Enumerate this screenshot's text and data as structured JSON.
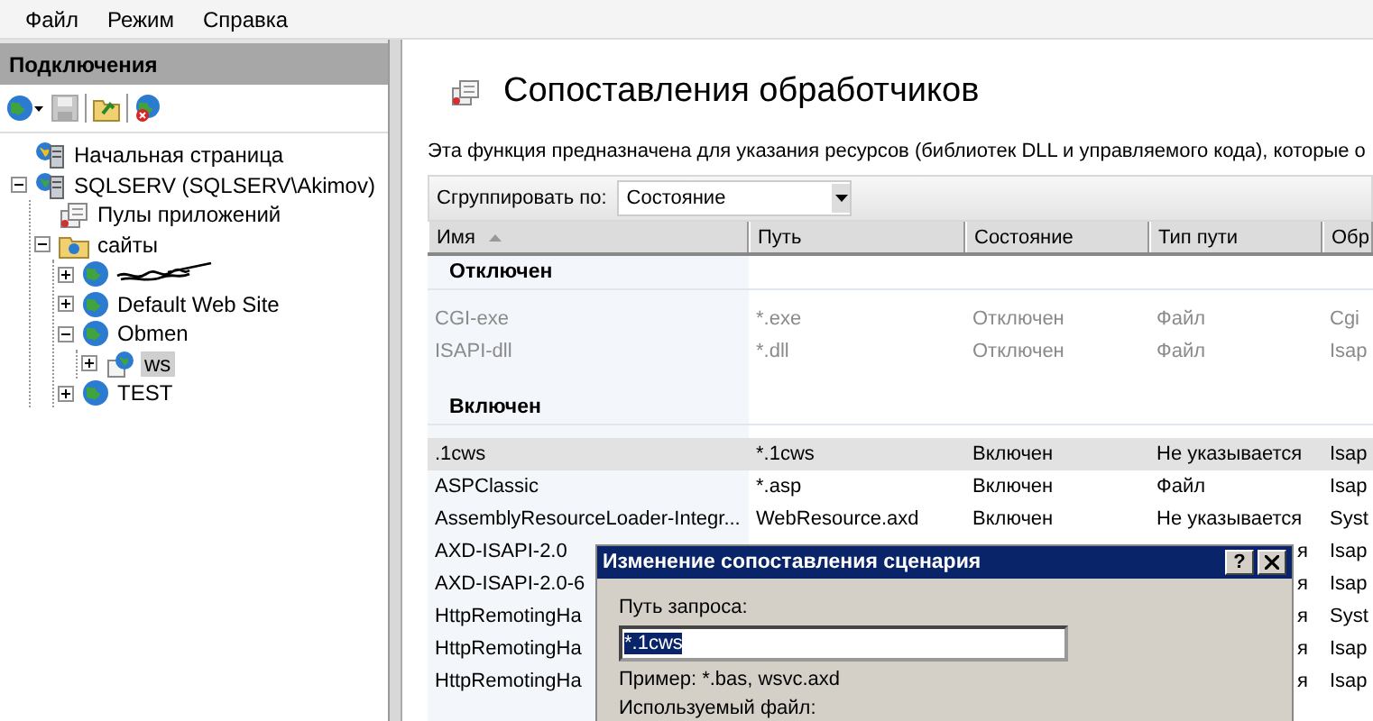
{
  "menu": [
    {
      "label": "Файл"
    },
    {
      "label": "Режим"
    },
    {
      "label": "Справка"
    }
  ],
  "connections": {
    "title": "Подключения",
    "tree": [
      {
        "label": "Начальная страница",
        "kind": "home",
        "selected": false
      },
      {
        "label": "SQLSERV (SQLSERV\\Akimov)",
        "kind": "server",
        "expanded": true,
        "selected": false,
        "children": [
          {
            "label": "Пулы приложений",
            "kind": "pool",
            "selected": false
          },
          {
            "label": "сайты",
            "kind": "folder",
            "expanded": true,
            "selected": false,
            "children": [
              {
                "kind": "redacted",
                "expanded": false,
                "selected": false
              },
              {
                "label": "Default Web Site",
                "kind": "site",
                "expanded": false,
                "selected": false
              },
              {
                "label": "Obmen",
                "kind": "site",
                "expanded": true,
                "selected": false,
                "children": [
                  {
                    "label": "ws",
                    "kind": "app",
                    "expanded": false,
                    "selected": true
                  }
                ]
              },
              {
                "label": "TEST",
                "kind": "site",
                "expanded": false,
                "selected": false
              }
            ]
          }
        ]
      }
    ]
  },
  "content": {
    "title": "Сопоставления обработчиков",
    "description": "Эта функция предназначена для указания ресурсов (библиотек DLL и управляемого кода), которые о",
    "group_by": {
      "label": "Сгруппировать по:",
      "value": "Состояние"
    },
    "columns": [
      "Имя",
      "Путь",
      "Состояние",
      "Тип пути",
      "Обр"
    ],
    "groups": [
      {
        "title": "Отключен",
        "disabled": true,
        "rows": [
          {
            "kind": "full",
            "selected": false,
            "cells": [
              "CGI-exe",
              "*.exe",
              "Отключен",
              "Файл",
              "Cgi"
            ]
          },
          {
            "kind": "full",
            "selected": false,
            "cells": [
              "ISAPI-dll",
              "*.dll",
              "Отключен",
              "Файл",
              "Isap"
            ]
          }
        ]
      },
      {
        "title": "Включен",
        "disabled": false,
        "rows": [
          {
            "kind": "full",
            "selected": true,
            "cells": [
              ".1cws",
              "*.1cws",
              "Включен",
              "Не указывается",
              "Isap"
            ]
          },
          {
            "kind": "full",
            "selected": false,
            "cells": [
              "ASPClassic",
              "*.asp",
              "Включен",
              "Файл",
              "Isap"
            ]
          },
          {
            "kind": "full",
            "selected": false,
            "cells": [
              "AssemblyResourceLoader-Integr...",
              "WebResource.axd",
              "Включен",
              "Не указывается",
              "Syst"
            ]
          },
          {
            "kind": "covered",
            "selected": false,
            "name": "AXD-ISAPI-2.0",
            "path_type": "я",
            "column_5": "Isap"
          },
          {
            "kind": "covered",
            "selected": false,
            "name": "AXD-ISAPI-2.0-6",
            "path_type": "я",
            "column_5": "Isap"
          },
          {
            "kind": "covered",
            "selected": false,
            "name": "HttpRemotingHa",
            "path_type": "я",
            "column_5": "Syst"
          },
          {
            "kind": "covered",
            "selected": false,
            "name": "HttpRemotingHa",
            "path_type": "я",
            "column_5": "Isap"
          },
          {
            "kind": "covered",
            "selected": false,
            "name": "HttpRemotingHa",
            "path_type": "я",
            "column_5": "Isap"
          }
        ]
      }
    ]
  },
  "dialog": {
    "title": "Изменение сопоставления сценария",
    "help": "?",
    "path_label": "Путь запроса:",
    "path_value": "*.1cws",
    "example": "Пример: *.bas, wsvc.axd",
    "file_label": "Используемый файл:"
  }
}
